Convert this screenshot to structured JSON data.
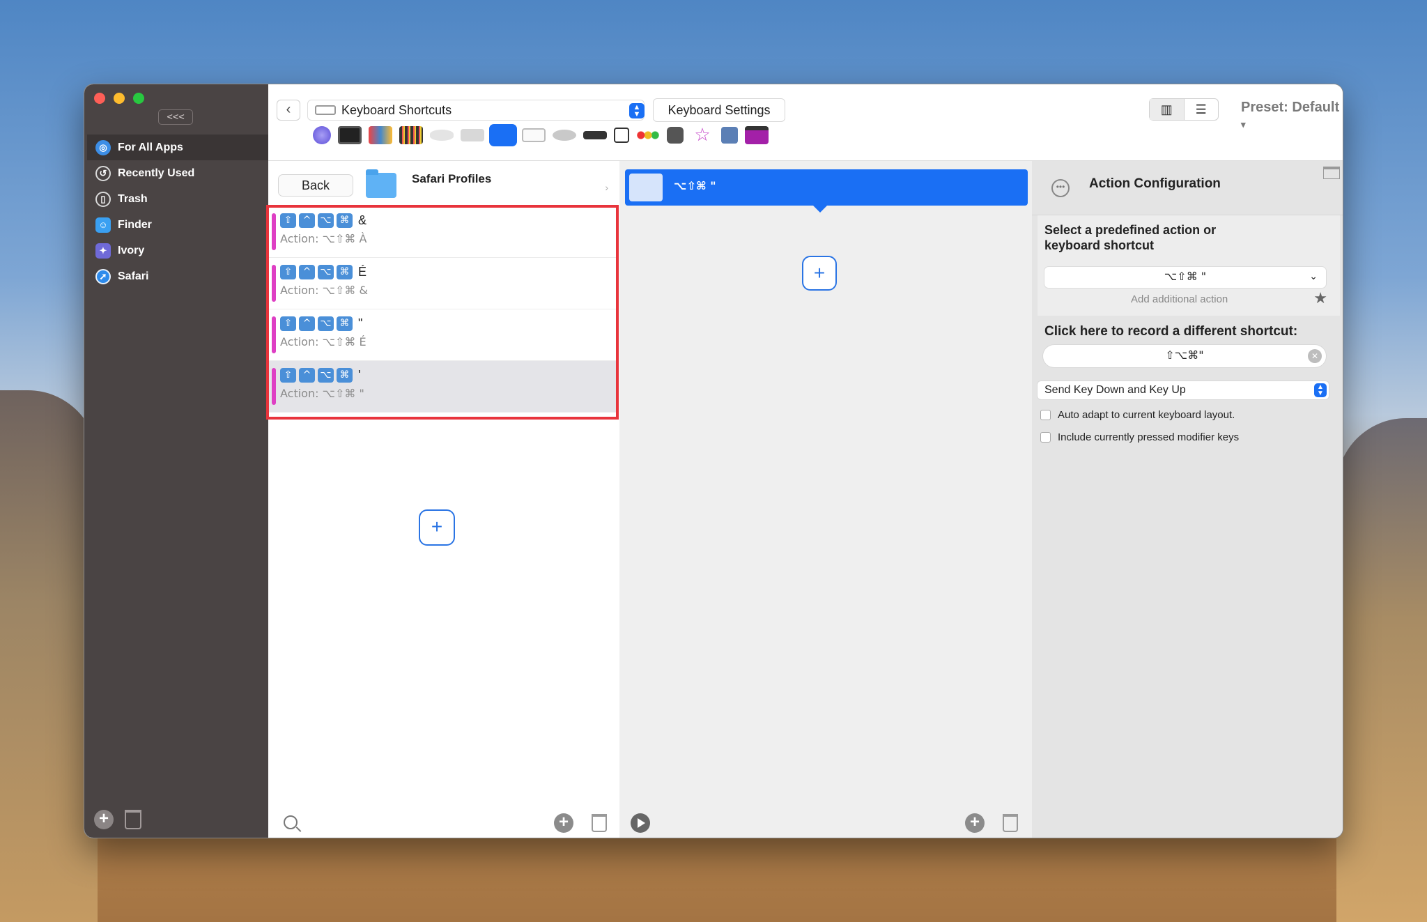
{
  "sidebar": {
    "collapse_label": "<<<",
    "items": [
      {
        "label": "For All Apps",
        "icon": "globe-icon",
        "active": true
      },
      {
        "label": "Recently Used",
        "icon": "clock-icon"
      },
      {
        "label": "Trash",
        "icon": "trash-icon"
      },
      {
        "label": "Finder",
        "icon": "finder-icon"
      },
      {
        "label": "Ivory",
        "icon": "ivory-icon"
      },
      {
        "label": "Safari",
        "icon": "compass-icon"
      }
    ]
  },
  "toolbar": {
    "trigger_type": "Keyboard Shortcuts",
    "settings_button": "Keyboard Settings",
    "preset_label": "Preset: Default",
    "accent": "#1a6ff4"
  },
  "triggers": {
    "back_label": "Back",
    "folder_name": "Safari Profiles",
    "modifier_keys": [
      "⇧",
      "^",
      "⌥",
      "⌘"
    ],
    "items": [
      {
        "key": "&",
        "action": "Action: ⌥⇧⌘ À"
      },
      {
        "key": "É",
        "action": "Action: ⌥⇧⌘ &"
      },
      {
        "key": "\"",
        "action": "Action: ⌥⇧⌘ É"
      },
      {
        "key": "'",
        "action": "Action: ⌥⇧⌘ \""
      }
    ]
  },
  "actions": {
    "selected_label": "⌥⇧⌘ \""
  },
  "config": {
    "title": "Action Configuration",
    "predefined_label_1": "Select a predefined action or",
    "predefined_label_2": "keyboard shortcut",
    "selected_shortcut": "⌥⇧⌘ \"",
    "add_additional": "Add additional action",
    "record_label": "Click here to record a different shortcut:",
    "recorded_value": "⇧⌥⌘\"",
    "send_mode": "Send Key Down and Key Up",
    "checkbox_1": "Auto adapt to current keyboard layout.",
    "checkbox_2": "Include currently pressed modifier keys"
  }
}
